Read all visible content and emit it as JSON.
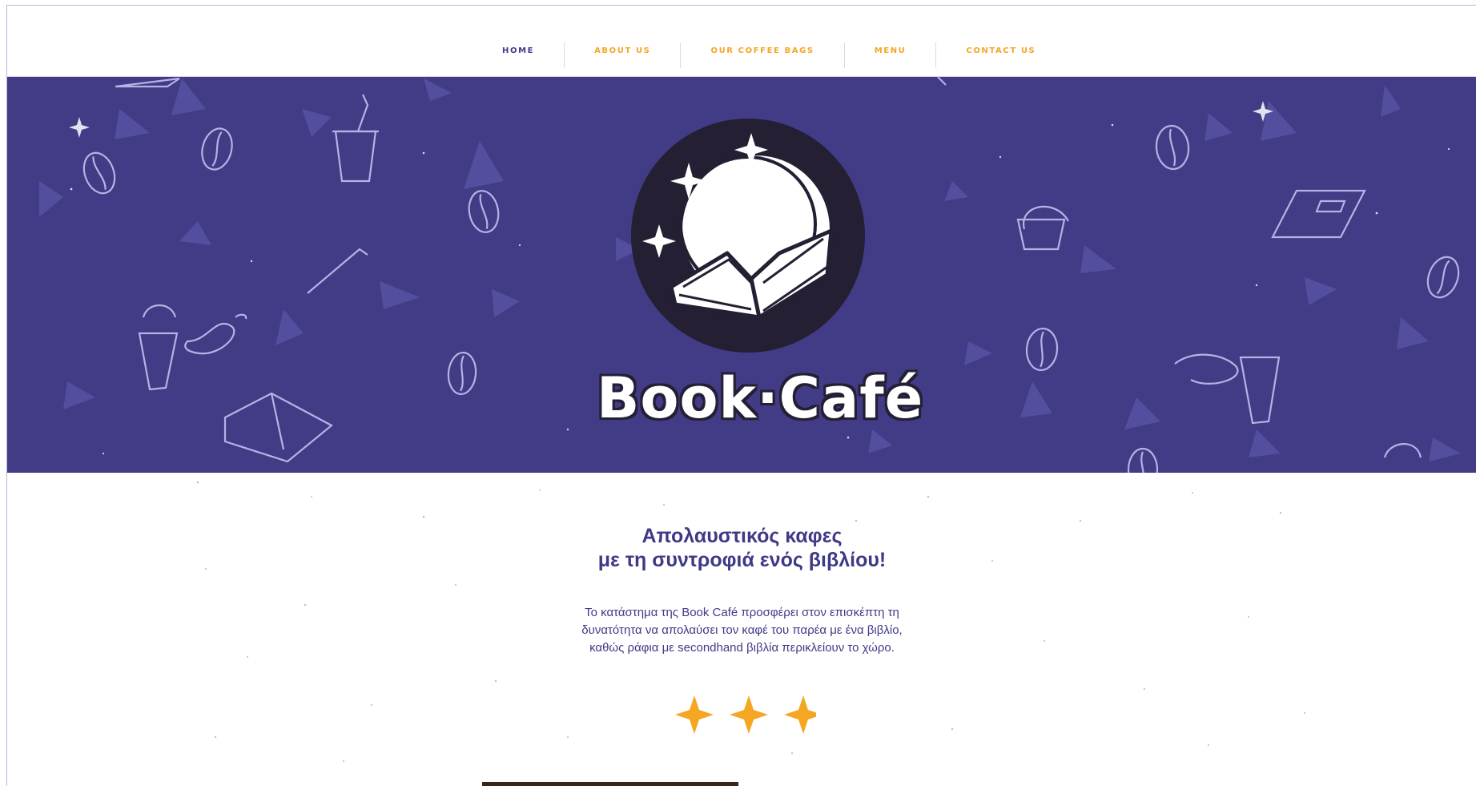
{
  "nav": {
    "items": [
      {
        "label": "HOME",
        "active": true
      },
      {
        "label": "ABOUT US",
        "active": false
      },
      {
        "label": "OUR COFFEE BAGS",
        "active": false
      },
      {
        "label": "MENU",
        "active": false
      },
      {
        "label": "CONTACT US",
        "active": false
      }
    ]
  },
  "hero": {
    "logo_text": "Book·Café",
    "logo_icon": "open-book-moon-icon",
    "background_color": "#423b86",
    "logo_circle_color": "#241f33"
  },
  "main": {
    "headline_line1": "Απολαυστικός καφες",
    "headline_line2": "με τη συντροφιά ενός βιβλίου!",
    "paragraph_line1": "Το κατάστημα της Book Café προσφέρει στον επισκέπτη τη",
    "paragraph_line2": "δυνατότητα να απολαύσει τον καφέ του παρέα με ένα βιβλίο,",
    "paragraph_line3": "καθώς ράφια με secondhand βιβλία περικλείουν το χώρο.",
    "stars_icon": "sparkle-star-icon",
    "stars_count": 3,
    "accent_color": "#f5a623",
    "text_color": "#3f3a86"
  }
}
